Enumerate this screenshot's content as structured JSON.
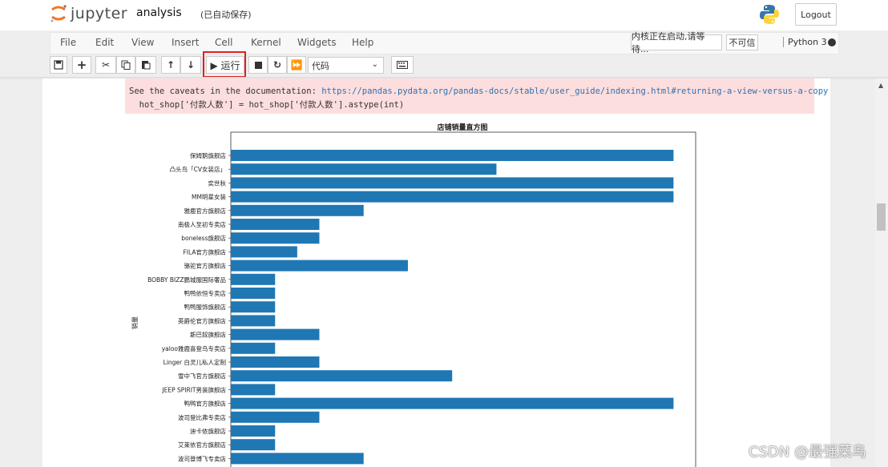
{
  "header": {
    "logo_text": "jupyter",
    "notebook_name": "analysis",
    "save_status": "(已自动保存)",
    "logout_label": "Logout"
  },
  "menu": {
    "items": [
      "File",
      "Edit",
      "View",
      "Insert",
      "Cell",
      "Kernel",
      "Widgets",
      "Help"
    ],
    "kernel_status": "内核正在启动,请等待...",
    "trust": "不可信",
    "kernel_name": "Python 3"
  },
  "toolbar": {
    "run_label": "▶ 运行",
    "cell_type": "代码"
  },
  "output": {
    "warning_line1_text": "See the caveats in the documentation: ",
    "warning_line1_link": "https://pandas.pydata.org/pandas-docs/stable/user_guide/indexing.html#returning-a-view-versus-a-copy",
    "warning_line2": "  hot_shop['付款人数'] = hot_shop['付款人数'].astype(int)"
  },
  "chart_data": {
    "type": "bar",
    "orientation": "horizontal",
    "title": "店铺销量直方图",
    "ylabel": "销量",
    "bar_color": "#1f77b4",
    "categories": [
      "保姆鹅旗舰店",
      "凸头鸟「CV女装店」",
      "奕世秋",
      "MM明星女装",
      "雅鹿官方旗舰店",
      "南极人至初专卖店",
      "boneless旗舰店",
      "FILA官方旗舰店",
      "骆驼官方旗舰店",
      "BOBBY BIZZ鹏城服国际奢品",
      "鸭鸭依恒专卖店",
      "鸭鸭服饰旗舰店",
      "英爵伦官方旗舰店",
      "斯巴奴旗舰店",
      "yaloo雅鹿喜登鸟专卖店",
      "Linger 白灵儿私人定制",
      "雪中飞官方旗舰店",
      "JEEP SPIRIT男装旗舰店",
      "鸭鸭官方旗舰店",
      "波司登比弗专卖店",
      "迪卡侬旗舰店",
      "艾莱依官方旗舰店",
      "波司登博飞专卖店"
    ],
    "values": [
      100,
      60,
      100,
      100,
      30,
      20,
      20,
      15,
      40,
      10,
      10,
      10,
      10,
      20,
      10,
      20,
      50,
      10,
      100,
      20,
      10,
      10,
      30
    ],
    "xlim": [
      0,
      105
    ]
  },
  "watermark": "CSDN @最强菜鸟",
  "colors": {
    "accent": "#1f77b4",
    "warning_bg": "#fddede",
    "highlight": "#e02020"
  }
}
